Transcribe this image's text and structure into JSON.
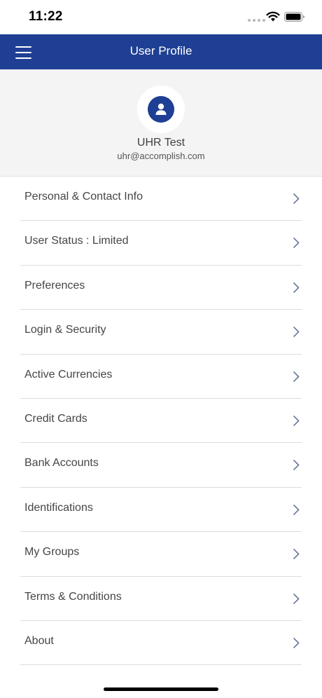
{
  "status_bar": {
    "time": "11:22",
    "icons": [
      "signal-dots-icon",
      "wifi-icon",
      "battery-icon"
    ]
  },
  "nav": {
    "title": "User Profile",
    "menu_icon": "hamburger-menu-icon",
    "color": "#1e3f93"
  },
  "profile": {
    "name": "UHR Test",
    "email": "uhr@accomplish.com",
    "avatar_icon": "user-avatar-icon"
  },
  "menu": {
    "items": [
      {
        "label": "Personal & Contact Info"
      },
      {
        "label": "User Status : Limited"
      },
      {
        "label": "Preferences"
      },
      {
        "label": "Login & Security"
      },
      {
        "label": "Active Currencies"
      },
      {
        "label": "Credit Cards"
      },
      {
        "label": "Bank Accounts"
      },
      {
        "label": "Identifications"
      },
      {
        "label": "My Groups"
      },
      {
        "label": "Terms & Conditions"
      },
      {
        "label": "About"
      }
    ],
    "item_icon": "chevron-right-icon"
  }
}
